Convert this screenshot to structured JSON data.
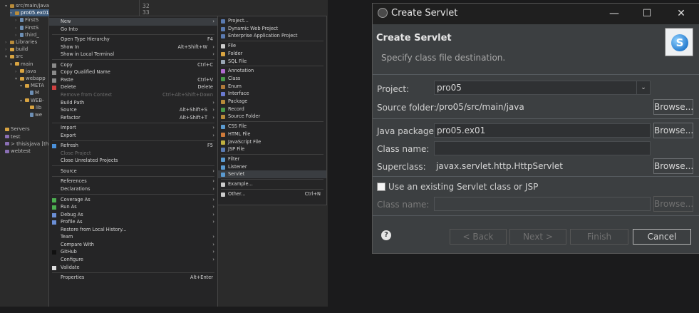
{
  "eclipse": {
    "tree": [
      {
        "label": "src/main/java",
        "indent": 1,
        "icon": "pkg",
        "twisty": "▾"
      },
      {
        "label": "pro05.ex01",
        "indent": 2,
        "icon": "pkg",
        "twisty": "▾",
        "selected": true
      },
      {
        "label": "FirstS",
        "indent": 3,
        "icon": "file",
        "twisty": "›"
      },
      {
        "label": "FirstS",
        "indent": 3,
        "icon": "file",
        "twisty": "›"
      },
      {
        "label": "third_",
        "indent": 3,
        "icon": "file",
        "twisty": "›"
      },
      {
        "label": "Libraries",
        "indent": 1,
        "icon": "pkg",
        "twisty": "›"
      },
      {
        "label": "build",
        "indent": 1,
        "icon": "folder",
        "twisty": "›"
      },
      {
        "label": "src",
        "indent": 1,
        "icon": "folder",
        "twisty": "▾"
      },
      {
        "label": "main",
        "indent": 2,
        "icon": "folder",
        "twisty": "▾"
      },
      {
        "label": "java",
        "indent": 3,
        "icon": "folder",
        "twisty": "›"
      },
      {
        "label": "webapp",
        "indent": 3,
        "icon": "folder",
        "twisty": "▾"
      },
      {
        "label": "META",
        "indent": 4,
        "icon": "folder",
        "twisty": "▾"
      },
      {
        "label": "M",
        "indent": 5,
        "icon": "file",
        "twisty": ""
      },
      {
        "label": "WEB-",
        "indent": 4,
        "icon": "folder",
        "twisty": "▾"
      },
      {
        "label": "lib",
        "indent": 5,
        "icon": "folder",
        "twisty": ""
      },
      {
        "label": "we",
        "indent": 5,
        "icon": "file",
        "twisty": ""
      },
      {
        "label": "",
        "indent": 0,
        "icon": "",
        "twisty": ""
      },
      {
        "label": "Servers",
        "indent": 0,
        "icon": "folder",
        "twisty": ""
      },
      {
        "label": "test",
        "indent": 0,
        "icon": "proj",
        "twisty": ""
      },
      {
        "label": "> thisisjava [thisis",
        "indent": 0,
        "icon": "proj",
        "twisty": ""
      },
      {
        "label": "webtest",
        "indent": 0,
        "icon": "proj",
        "twisty": ""
      }
    ],
    "editor_lines": [
      "32",
      "33"
    ],
    "context_menu": [
      {
        "label": "New",
        "arrow": true,
        "hl": true,
        "icon": ""
      },
      {
        "label": "Go Into"
      },
      {
        "sep": true
      },
      {
        "label": "Open Type Hierarchy",
        "key": "F4"
      },
      {
        "label": "Show In",
        "key": "Alt+Shift+W",
        "arrow": true
      },
      {
        "label": "Show in Local Terminal",
        "arrow": true
      },
      {
        "sep": true
      },
      {
        "label": "Copy",
        "key": "Ctrl+C",
        "icon": "#8a8a8a"
      },
      {
        "label": "Copy Qualified Name",
        "icon": "#8a8a8a"
      },
      {
        "label": "Paste",
        "key": "Ctrl+V",
        "icon": "#8a8a8a"
      },
      {
        "label": "Delete",
        "key": "Delete",
        "icon": "#d04040"
      },
      {
        "label": "Remove from Context",
        "key": "Ctrl+Alt+Shift+Down",
        "dis": true
      },
      {
        "label": "Build Path",
        "arrow": true
      },
      {
        "label": "Source",
        "key": "Alt+Shift+S",
        "arrow": true
      },
      {
        "label": "Refactor",
        "key": "Alt+Shift+T",
        "arrow": true
      },
      {
        "sep": true
      },
      {
        "label": "Import",
        "arrow": true
      },
      {
        "label": "Export",
        "arrow": true
      },
      {
        "sep": true
      },
      {
        "label": "Refresh",
        "key": "F5",
        "icon": "#4a90d9"
      },
      {
        "label": "Close Project",
        "dis": true
      },
      {
        "label": "Close Unrelated Projects"
      },
      {
        "sep": true
      },
      {
        "label": "Source",
        "arrow": true
      },
      {
        "sep": true
      },
      {
        "label": "References",
        "arrow": true
      },
      {
        "label": "Declarations",
        "arrow": true
      },
      {
        "sep": true
      },
      {
        "label": "Coverage As",
        "arrow": true,
        "icon": "#4caf50"
      },
      {
        "label": "Run As",
        "arrow": true,
        "icon": "#4caf50"
      },
      {
        "label": "Debug As",
        "arrow": true,
        "icon": "#6b8fd6"
      },
      {
        "label": "Profile As",
        "arrow": true,
        "icon": "#6b8fd6"
      },
      {
        "label": "Restore from Local History..."
      },
      {
        "label": "Team",
        "arrow": true
      },
      {
        "label": "Compare With",
        "arrow": true
      },
      {
        "label": "GitHub",
        "arrow": true,
        "icon": "#111111"
      },
      {
        "label": "Configure",
        "arrow": true
      },
      {
        "label": "Validate",
        "icon": "#dddddd"
      },
      {
        "sep": true
      },
      {
        "label": "Properties",
        "key": "Alt+Enter"
      }
    ],
    "submenu": [
      {
        "label": "Project...",
        "icon": "#5a7ab0"
      },
      {
        "label": "Dynamic Web Project",
        "icon": "#5a7ab0"
      },
      {
        "label": "Enterprise Application Project",
        "icon": "#5a7ab0"
      },
      {
        "sep": true
      },
      {
        "label": "File",
        "icon": "#cccccc"
      },
      {
        "label": "Folder",
        "icon": "#d9a441"
      },
      {
        "label": "SQL File",
        "icon": "#9aa7b5"
      },
      {
        "sep": true
      },
      {
        "label": "Annotation",
        "icon": "#b06ad0"
      },
      {
        "label": "Class",
        "icon": "#4a9a4a"
      },
      {
        "label": "Enum",
        "icon": "#b07a3a"
      },
      {
        "label": "Interface",
        "icon": "#6a7ad0"
      },
      {
        "label": "Package",
        "icon": "#b88b3a"
      },
      {
        "label": "Record",
        "icon": "#4a9a4a"
      },
      {
        "label": "Source Folder",
        "icon": "#b88b3a"
      },
      {
        "sep": true
      },
      {
        "label": "CSS File",
        "icon": "#5a9ad0"
      },
      {
        "label": "HTML File",
        "icon": "#d07a3a"
      },
      {
        "label": "JavaScript File",
        "icon": "#c0b040"
      },
      {
        "label": "JSP File",
        "icon": "#5a7ab0"
      },
      {
        "sep": true
      },
      {
        "label": "Filter",
        "icon": "#5a9ad0"
      },
      {
        "label": "Listener",
        "icon": "#5a9ad0"
      },
      {
        "label": "Servlet",
        "icon": "#5a9ad0",
        "hl": true
      },
      {
        "sep": true
      },
      {
        "label": "Example...",
        "icon": "#cccccc"
      },
      {
        "sep": true
      },
      {
        "label": "Other...",
        "key": "Ctrl+N",
        "icon": "#cccccc"
      }
    ]
  },
  "dialog": {
    "window_title": "Create Servlet",
    "header_title": "Create Servlet",
    "header_desc": "Specify class file destination.",
    "logo_letter": "S",
    "project_label": "Project:",
    "project_value": "pro05",
    "source_folder_label": "Source folder:",
    "source_folder_value": "/pro05/src/main/java",
    "browse1": "Browse...",
    "java_package_label": "Java package:",
    "java_package_value": "pro05.ex01",
    "browse2": "Browse...",
    "class_name_label": "Class name:",
    "class_name_value": "",
    "superclass_label": "Superclass:",
    "superclass_value": "javax.servlet.http.HttpServlet",
    "browse3": "Browse...",
    "existing_label": "Use an existing Servlet class or JSP",
    "class_name2_label": "Class name:",
    "browse4": "Browse...",
    "back": "< Back",
    "next": "Next >",
    "finish": "Finish",
    "cancel": "Cancel"
  }
}
